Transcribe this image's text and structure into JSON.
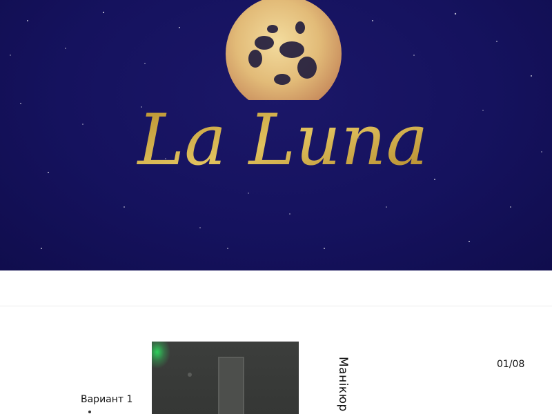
{
  "hero": {
    "logo_text": "La Luna",
    "colors": {
      "background": "#15125e",
      "logo_gold": "#c9a440",
      "moon": "#e6c98a"
    }
  },
  "gallery": {
    "variant_label": "Вариант 1",
    "vertical_title": "Манікюр",
    "counter": "01/08"
  }
}
